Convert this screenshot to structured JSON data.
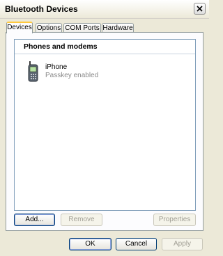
{
  "window": {
    "title": "Bluetooth Devices"
  },
  "tabs": [
    {
      "label": "Devices",
      "active": true
    },
    {
      "label": "Options",
      "active": false
    },
    {
      "label": "COM Ports",
      "active": false
    },
    {
      "label": "Hardware",
      "active": false
    }
  ],
  "devices_group": {
    "header": "Phones and modems",
    "items": [
      {
        "name": "iPhone",
        "status": "Passkey enabled",
        "icon": "mobile-phone-icon"
      }
    ]
  },
  "panel_buttons": {
    "add": "Add...",
    "remove": "Remove",
    "properties": "Properties"
  },
  "dialog_buttons": {
    "ok": "OK",
    "cancel": "Cancel",
    "apply": "Apply"
  },
  "colors": {
    "accent_tab": "#ffc83c",
    "button_border": "#003c74",
    "disabled_text": "#a19f95"
  }
}
